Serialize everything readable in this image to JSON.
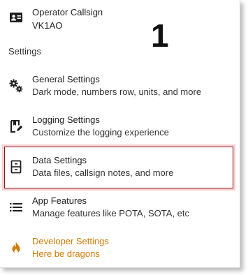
{
  "account": {
    "title": "Operator Callsign",
    "subtitle": "VK1AO",
    "icon": "id-card-icon"
  },
  "annotation": "1",
  "section_header": "Settings",
  "items": [
    {
      "title": "General Settings",
      "subtitle": "Dark mode, numbers row, units, and more",
      "icon": "gears-icon"
    },
    {
      "title": "Logging Settings",
      "subtitle": "Customize the logging experience",
      "icon": "logbook-edit-icon"
    },
    {
      "title": "Data Settings",
      "subtitle": "Data files, callsign notes, and more",
      "icon": "file-cabinet-icon"
    },
    {
      "title": "App Features",
      "subtitle": "Manage features like POTA, SOTA, etc",
      "icon": "list-icon"
    },
    {
      "title": "Developer Settings",
      "subtitle": "Here be dragons",
      "icon": "fire-icon"
    }
  ],
  "colors": {
    "developer_accent": "#d27a00",
    "highlight_border": "#8a1c1c"
  }
}
